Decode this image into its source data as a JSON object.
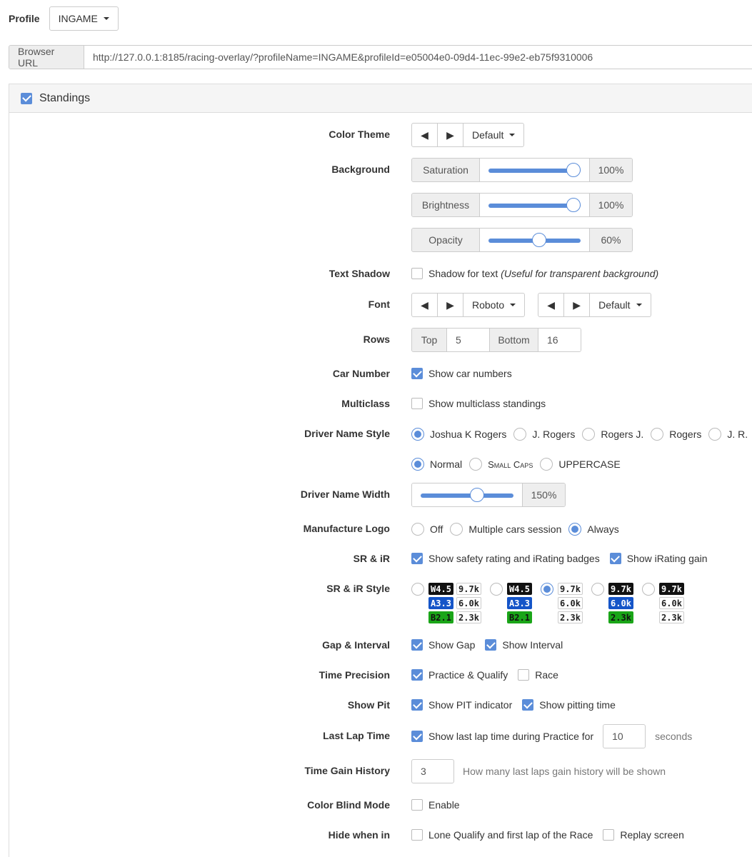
{
  "profile": {
    "label": "Profile",
    "value": "INGAME"
  },
  "url": {
    "label": "Browser URL",
    "value": "http://127.0.0.1:8185/racing-overlay/?profileName=INGAME&profileId=e05004e0-09d4-11ec-99e2-eb75f9310006"
  },
  "panel": {
    "title": "Standings",
    "enabled": true
  },
  "color_theme": {
    "label": "Color Theme",
    "prev": "◀",
    "next": "▶",
    "value": "Default"
  },
  "background": {
    "label": "Background",
    "sliders": [
      {
        "name": "Saturation",
        "value": "100%",
        "level": 1.0
      },
      {
        "name": "Brightness",
        "value": "100%",
        "level": 1.0
      },
      {
        "name": "Opacity",
        "value": "60%",
        "level": 0.6
      }
    ]
  },
  "text_shadow": {
    "label": "Text Shadow",
    "option": "Shadow for text",
    "note": "(Useful for transparent background)",
    "checked": false
  },
  "font": {
    "label": "Font",
    "prev": "◀",
    "next": "▶",
    "family": "Roboto",
    "weight": "Default"
  },
  "rows": {
    "label": "Rows",
    "top_label": "Top",
    "top_value": "5",
    "bottom_label": "Bottom",
    "bottom_value": "16"
  },
  "car_number": {
    "label": "Car Number",
    "option": "Show car numbers",
    "checked": true
  },
  "multiclass": {
    "label": "Multiclass",
    "option": "Show multiclass standings",
    "checked": false
  },
  "driver_name_style": {
    "label": "Driver Name Style",
    "formats": [
      "Joshua K Rogers",
      "J. Rogers",
      "Rogers J.",
      "Rogers",
      "J. R."
    ],
    "selected_format": 0,
    "cases": [
      "Normal",
      "Small Caps",
      "UPPERCASE"
    ],
    "selected_case": 0
  },
  "driver_name_width": {
    "label": "Driver Name Width",
    "value": "150%",
    "level": 0.6
  },
  "manufacture_logo": {
    "label": "Manufacture Logo",
    "options": [
      "Off",
      "Multiple cars session",
      "Always"
    ],
    "selected": 2
  },
  "sr_ir": {
    "label": "SR & iR",
    "options": [
      "Show safety rating and iRating badges",
      "Show iRating gain"
    ],
    "checked": [
      true,
      true
    ]
  },
  "sr_ir_style": {
    "label": "SR & iR Style",
    "selected": 2,
    "left_badges": [
      "W4.5",
      "A3.3",
      "B2.1"
    ],
    "right_badges": [
      "9.7k",
      "6.0k",
      "2.3k"
    ]
  },
  "gap_interval": {
    "label": "Gap & Interval",
    "options": [
      "Show Gap",
      "Show Interval"
    ],
    "checked": [
      true,
      true
    ]
  },
  "time_precision": {
    "label": "Time Precision",
    "options": [
      "Practice & Qualify",
      "Race"
    ],
    "checked": [
      true,
      false
    ]
  },
  "show_pit": {
    "label": "Show Pit",
    "options": [
      "Show PIT indicator",
      "Show pitting time"
    ],
    "checked": [
      true,
      true
    ]
  },
  "last_lap": {
    "label": "Last Lap Time",
    "option": "Show last lap time during Practice for",
    "value": "10",
    "unit": "seconds",
    "checked": true
  },
  "time_gain": {
    "label": "Time Gain History",
    "value": "3",
    "hint": "How many last laps gain history will be shown"
  },
  "color_blind": {
    "label": "Color Blind Mode",
    "option": "Enable",
    "checked": false
  },
  "hide_when": {
    "label": "Hide when in",
    "options": [
      "Lone Qualify and first lap of the Race",
      "Replay screen"
    ],
    "checked": [
      false,
      false
    ]
  },
  "colors": {
    "accent": "#5b8dd9",
    "badge_blue": "#1555c8",
    "badge_green": "#1aa518",
    "badge_black": "#111111"
  }
}
